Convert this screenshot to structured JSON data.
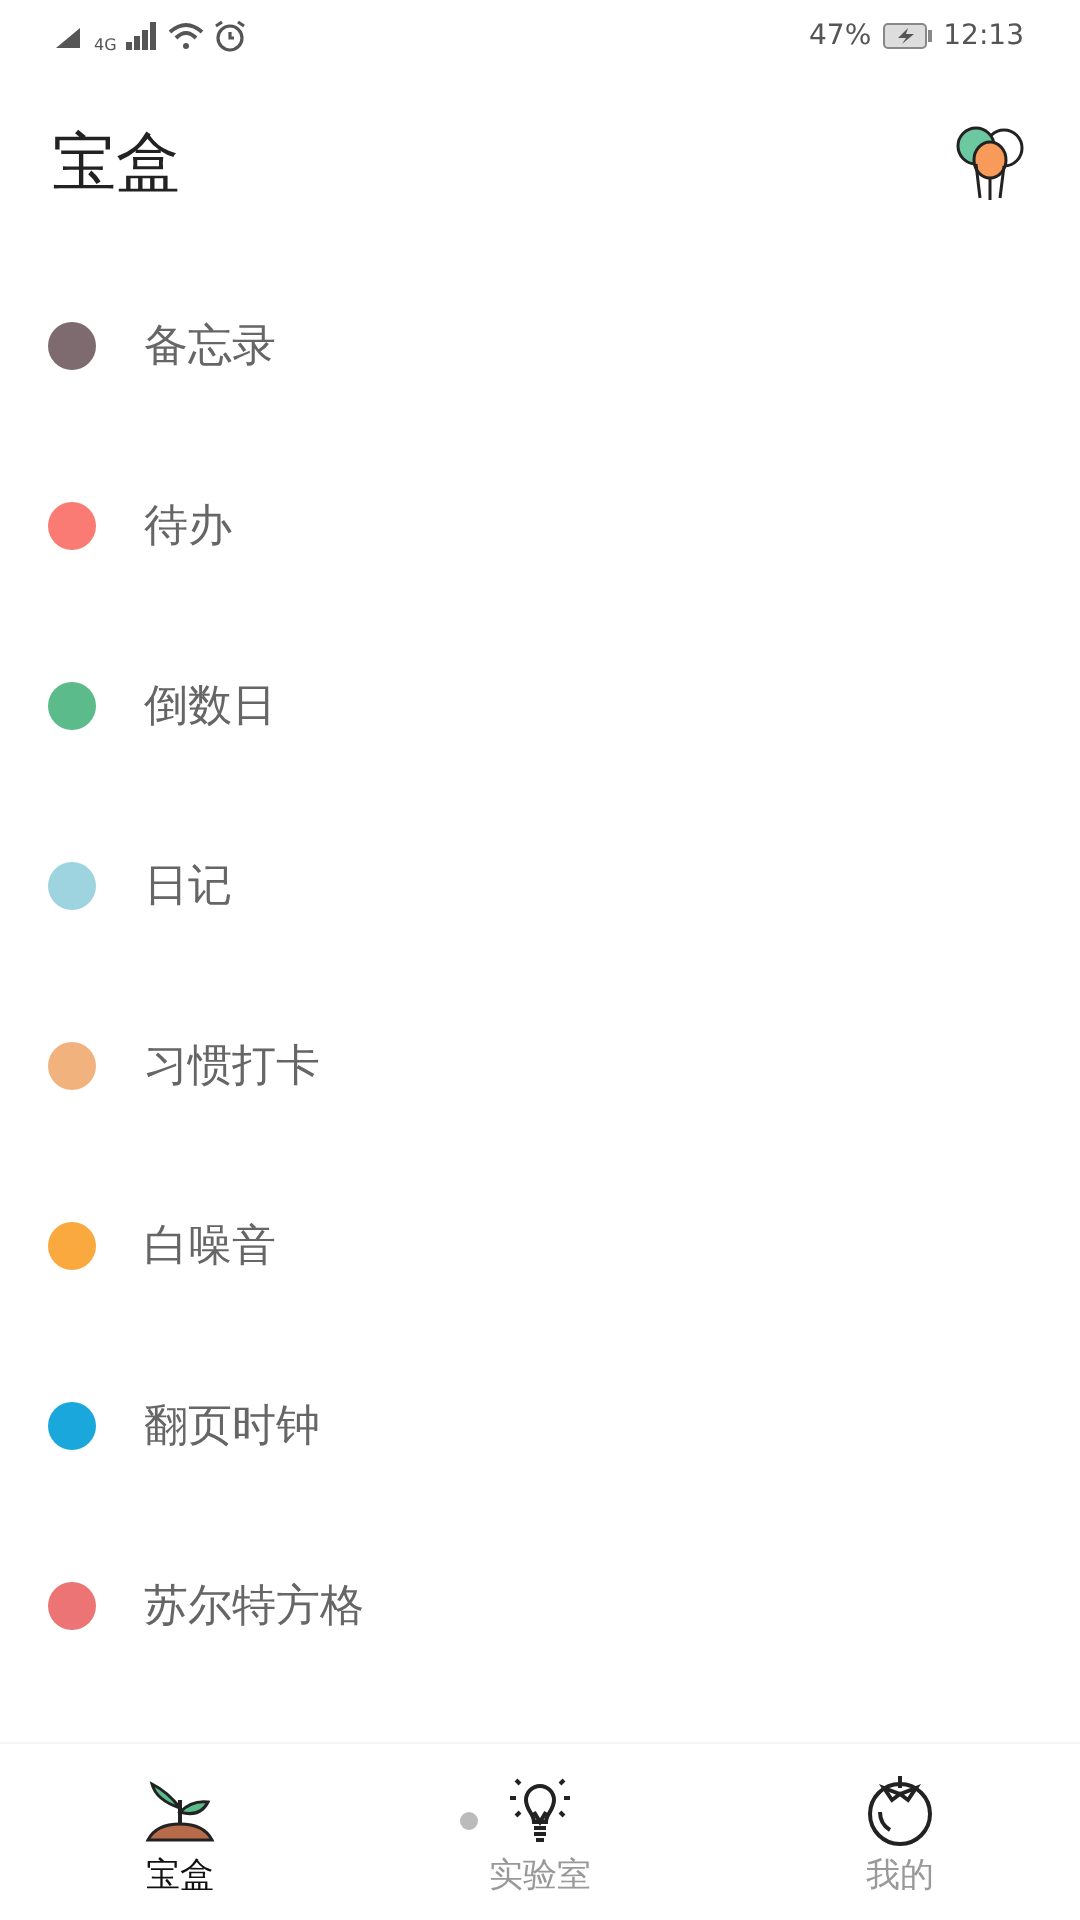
{
  "status_bar": {
    "network": "4G",
    "battery": "47%",
    "time": "12:13"
  },
  "header": {
    "title": "宝盒"
  },
  "items": [
    {
      "label": "备忘录",
      "color": "#7d6b70"
    },
    {
      "label": "待办",
      "color": "#f97b74"
    },
    {
      "label": "倒数日",
      "color": "#5bbb8a"
    },
    {
      "label": "日记",
      "color": "#9ed3e0"
    },
    {
      "label": "习惯打卡",
      "color": "#f2b27e"
    },
    {
      "label": "白噪音",
      "color": "#f9a93d"
    },
    {
      "label": "翻页时钟",
      "color": "#1aa8dc"
    },
    {
      "label": "苏尔特方格",
      "color": "#ec7474"
    }
  ],
  "bottom_nav": [
    {
      "label": "宝盒",
      "kind": "sprout",
      "selected": true
    },
    {
      "label": "实验室",
      "kind": "bulb",
      "selected": false
    },
    {
      "label": "我的",
      "kind": "tomato",
      "selected": false
    }
  ]
}
